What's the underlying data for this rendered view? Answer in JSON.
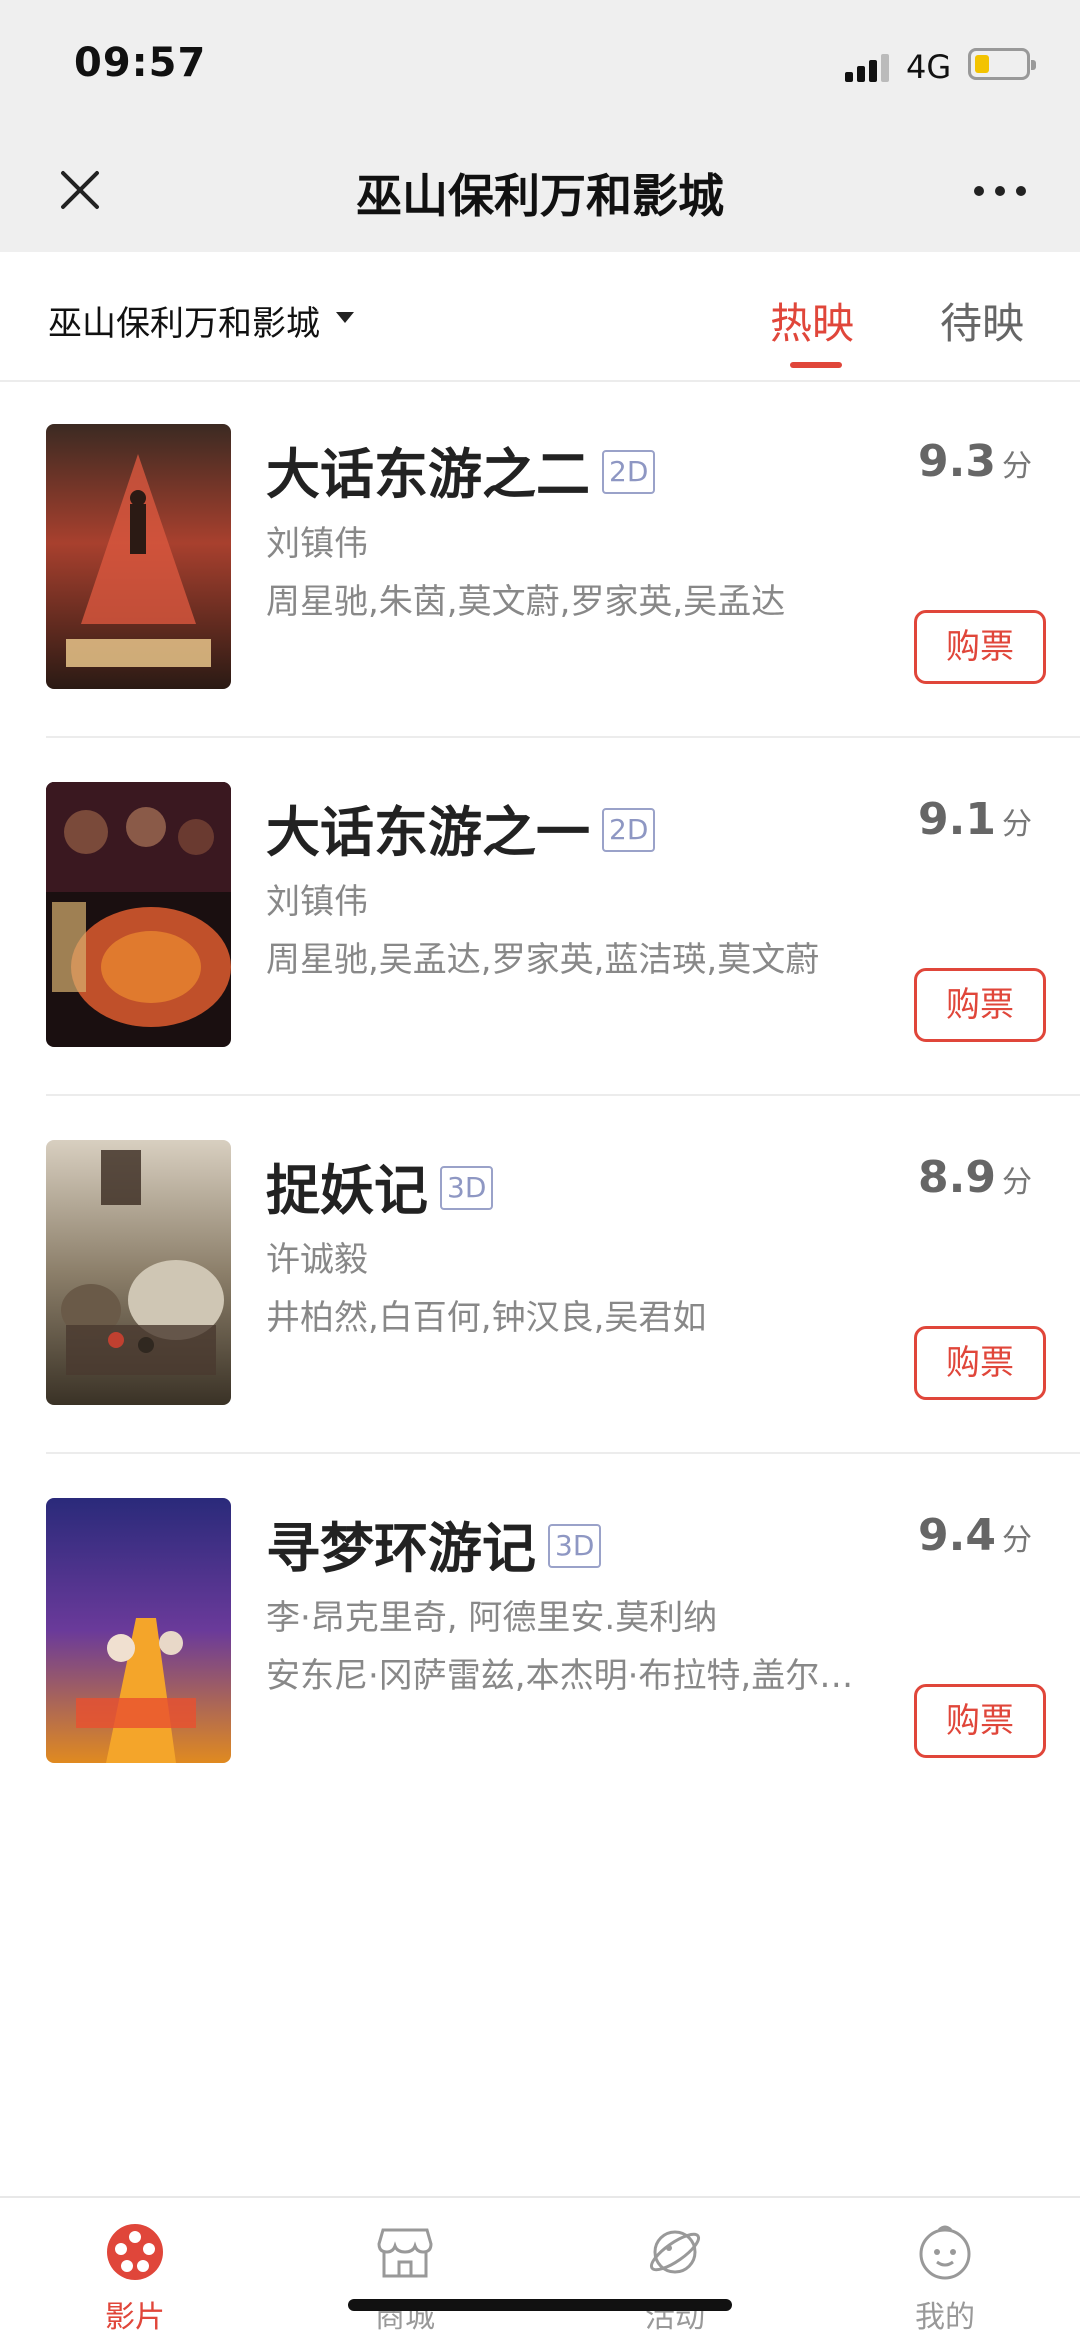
{
  "status_bar": {
    "time": "09:57",
    "network": "4G"
  },
  "nav": {
    "title": "巫山保利万和影城"
  },
  "subbar": {
    "cinema": "巫山保利万和影城",
    "tabs": [
      {
        "label": "热映",
        "active": true
      },
      {
        "label": "待映",
        "active": false
      }
    ]
  },
  "movies": [
    {
      "title": "大话东游之二",
      "format": "2D",
      "director": "刘镇伟",
      "actors": "周星驰,朱茵,莫文蔚,罗家英,吴孟达",
      "score": "9.3",
      "score_unit": "分",
      "buy_label": "购票"
    },
    {
      "title": "大话东游之一",
      "format": "2D",
      "director": "刘镇伟",
      "actors": "周星驰,吴孟达,罗家英,蓝洁瑛,莫文蔚",
      "score": "9.1",
      "score_unit": "分",
      "buy_label": "购票"
    },
    {
      "title": "捉妖记",
      "format": "3D",
      "director": "许诚毅",
      "actors": "井柏然,白百何,钟汉良,吴君如",
      "score": "8.9",
      "score_unit": "分",
      "buy_label": "购票"
    },
    {
      "title": "寻梦环游记",
      "format": "3D",
      "director": "李·昂克里奇, 阿德里安.莫利纳",
      "actors": "安东尼·冈萨雷兹,本杰明·布拉特,盖尔…",
      "score": "9.4",
      "score_unit": "分",
      "buy_label": "购票"
    }
  ],
  "tabbar": {
    "items": [
      {
        "label": "影片",
        "icon": "film-reel-icon",
        "active": true
      },
      {
        "label": "商城",
        "icon": "store-icon",
        "active": false
      },
      {
        "label": "活动",
        "icon": "planet-icon",
        "active": false
      },
      {
        "label": "我的",
        "icon": "face-icon",
        "active": false
      }
    ]
  },
  "colors": {
    "accent": "#e0463a",
    "header_bg": "#efefef",
    "format_badge": "#8e97c3"
  }
}
